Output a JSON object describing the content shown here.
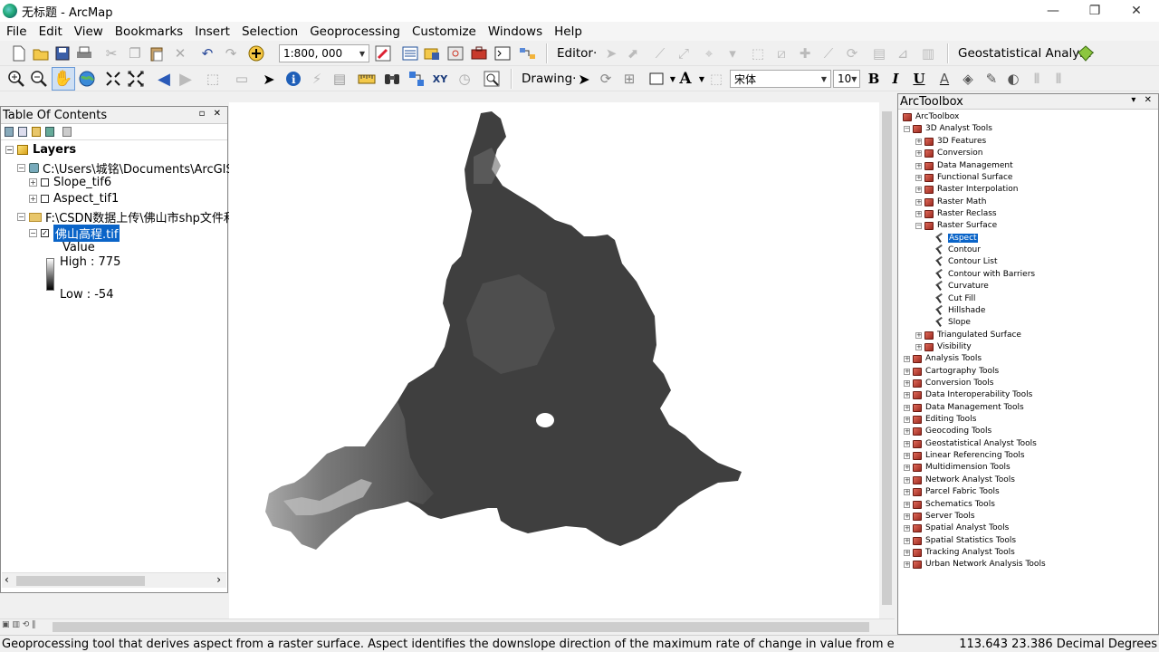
{
  "window": {
    "title": "无标题 - ArcMap",
    "minimize_glyph": "—",
    "maximize_glyph": "❐",
    "close_glyph": "✕"
  },
  "menu": [
    "File",
    "Edit",
    "View",
    "Bookmarks",
    "Insert",
    "Selection",
    "Geoprocessing",
    "Customize",
    "Windows",
    "Help"
  ],
  "toolbar": {
    "scale_value": "1:800, 000",
    "editor_label": "Editor·",
    "geostat_label": "Geostatistical Analyst·",
    "drawing_label": "Drawing·",
    "font_name": "宋体",
    "font_size": "10",
    "bold": "B",
    "italic": "I",
    "underline": "U",
    "text_tool": "A"
  },
  "toc": {
    "title": "Table Of Contents",
    "pane_buttons": "▫ ✕",
    "layers_label": "Layers",
    "group1_path": "C:\\Users\\城铭\\Documents\\ArcGIS\\De",
    "layer_slope": "Slope_tif6",
    "layer_aspect": "Aspect_tif1",
    "group2_path": "F:\\CSDN数据上传\\佛山市shp文件和高",
    "layer_dem": "佛山高程.tif",
    "legend_heading": "Value",
    "legend_high": "High : 775",
    "legend_low": "Low : -54",
    "expander_minus": "−",
    "expander_plus": "+",
    "checked_glyph": "✓",
    "scroll_left": "‹",
    "scroll_right": "›"
  },
  "toolbox": {
    "title": "ArcToolbox",
    "pane_buttons": "▾ ✕",
    "root": "ArcToolbox",
    "analyst3d": "3D Analyst Tools",
    "analyst3d_children": [
      "3D Features",
      "Conversion",
      "Data Management",
      "Functional Surface",
      "Raster Interpolation",
      "Raster Math",
      "Raster Reclass",
      "Raster Surface"
    ],
    "raster_surface_tools": [
      "Aspect",
      "Contour",
      "Contour List",
      "Contour with Barriers",
      "Curvature",
      "Cut Fill",
      "Hillshade",
      "Slope"
    ],
    "analyst3d_after": [
      "Triangulated Surface",
      "Visibility"
    ],
    "toolboxes": [
      "Analysis Tools",
      "Cartography Tools",
      "Conversion Tools",
      "Data Interoperability Tools",
      "Data Management Tools",
      "Editing Tools",
      "Geocoding Tools",
      "Geostatistical Analyst Tools",
      "Linear Referencing Tools",
      "Multidimension Tools",
      "Network Analyst Tools",
      "Parcel Fabric Tools",
      "Schematics Tools",
      "Server Tools",
      "Spatial Analyst Tools",
      "Spatial Statistics Tools",
      "Tracking Analyst Tools",
      "Urban Network Analysis Tools"
    ]
  },
  "status": {
    "message": "Geoprocessing tool that derives aspect from a raster surface. Aspect identifies the downslope direction of the maximum rate of change in value from each cell to its neighbo",
    "coords": "113.643  23.386 Decimal Degrees",
    "layout_tabs": "▣ ▥ ⟲ ‖"
  },
  "colors": {
    "selection": "#0a64c8",
    "dem_dark": "#3b3b3b",
    "dem_light": "#9a9a9a"
  }
}
